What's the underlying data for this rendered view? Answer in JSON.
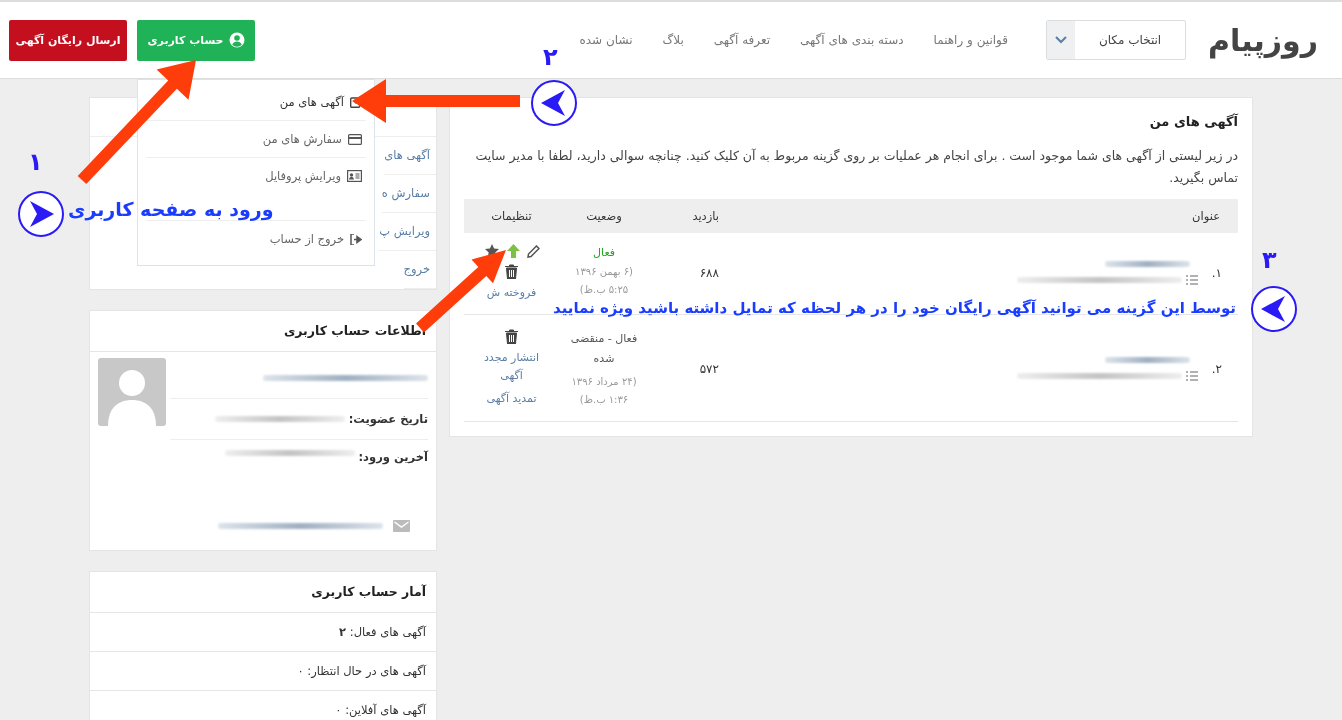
{
  "header": {
    "logo": "روزپیام",
    "location_select": {
      "value": "انتخاب مکان"
    },
    "nav": [
      "قوانین و راهنما",
      "دسته بندی های آگهی",
      "تعرفه آگهی",
      "بلاگ",
      "نشان شده"
    ],
    "account_button": "حساب کاربری",
    "post_button": "ارسال رایگان آگهی"
  },
  "account_menu": {
    "items": [
      "آگهی های من",
      "سفارش های من",
      "ویرایش پروفایل",
      "خروج از حساب"
    ]
  },
  "sidebar": {
    "menu_card": {
      "items": [
        "آگهی های",
        "سفارش ه",
        "ویرایش پ",
        "خروج"
      ]
    },
    "info_card": {
      "title": "اطلاعات حساب کاربری",
      "joined_label": "تاریخ عضویت:",
      "last_login_label": "آخرین ورود:"
    },
    "stats_card": {
      "title": "آمار حساب کاربری",
      "rows": [
        "آگهی های فعال: **۲**",
        "آگهی های در حال انتظار: ۰",
        "آگهی های آفلاین: ۰"
      ]
    }
  },
  "main": {
    "title": "آگهی های من",
    "description": "در زیر لیستی از آگهی های شما موجود است . برای انجام هر عملیات بر روی گزینه مربوط به آن کلیک کنید. چنانچه سوالی دارید، لطفا با مدیر سایت تماس بگیرید.",
    "table": {
      "columns": [
        "عنوان",
        "بازدید",
        "وضعیت",
        "تنظیمات"
      ],
      "rows": [
        {
          "index": "۱.",
          "views": "۶۸۸",
          "status": "فعال",
          "kind": "active",
          "date": "(۶ بهمن ۱۳۹۶ ۵:۲۵ ب.ظ)",
          "quick_actions": true,
          "links": [
            "فروخته ش"
          ]
        },
        {
          "index": "۲.",
          "views": "۵۷۲",
          "status": "فعال - منقضی شده",
          "kind": "expired",
          "date": "(۲۴ مرداد ۱۳۹۶ ۱:۳۶ ب.ظ)",
          "quick_actions": false,
          "links": [
            "انتشار مجدد آگهی",
            "تمدید آگهی"
          ]
        }
      ]
    }
  },
  "annotations": [
    {
      "number": "۱",
      "caption": "ورود به صفحه کاربری"
    },
    {
      "number": "۲"
    },
    {
      "number": "۳",
      "caption": "توسط این گزینه می توانید آگهی رایگان خود را در هر لحظه که تمایل داشته باشید ویژه نمایید"
    }
  ]
}
